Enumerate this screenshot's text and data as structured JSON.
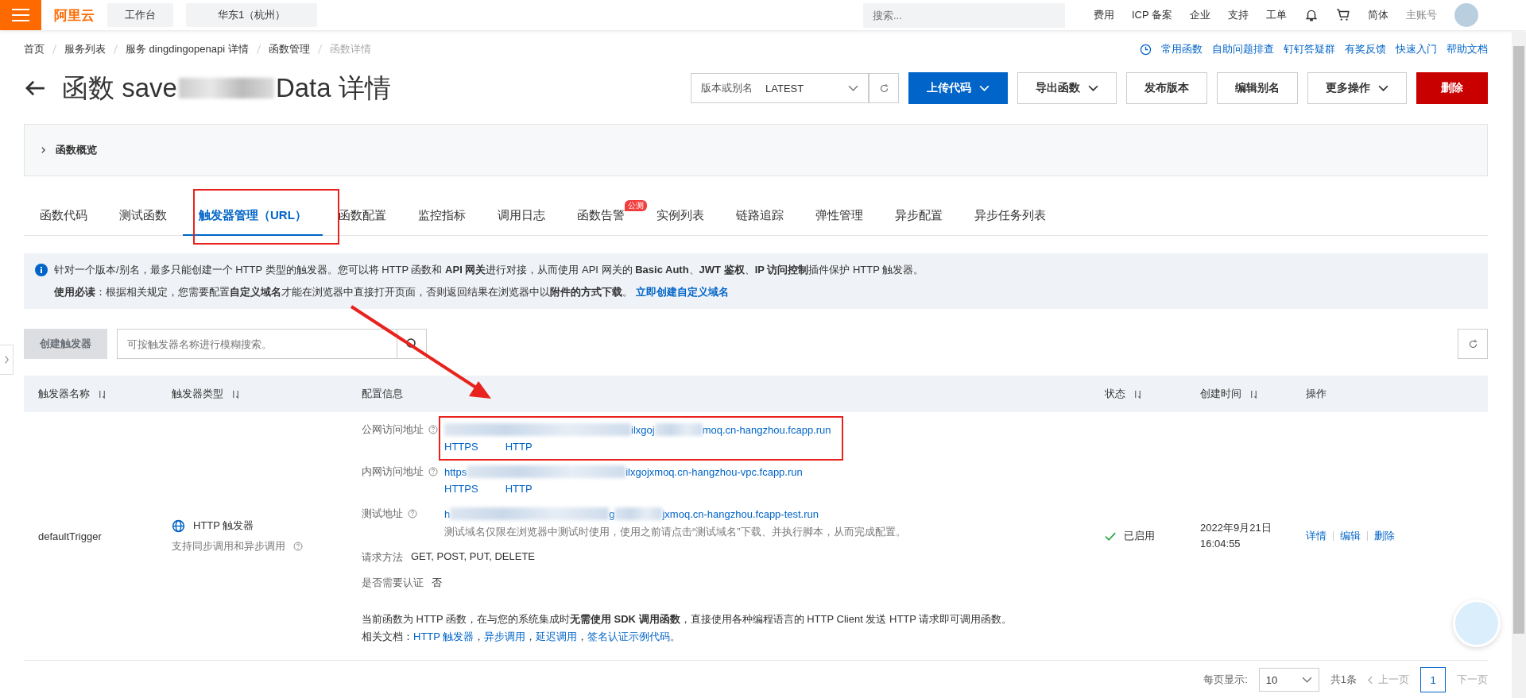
{
  "top_bar": {
    "logo": "阿里云",
    "workbench": "工作台",
    "region": "华东1（杭州）",
    "search": {
      "placeholder": "搜索..."
    },
    "links": [
      "费用",
      "ICP 备案",
      "企业",
      "支持",
      "工单"
    ],
    "language": "简体",
    "account": "主账号"
  },
  "breadcrumb": [
    {
      "label": "首页",
      "current": false
    },
    {
      "label": "服务列表",
      "current": false
    },
    {
      "label": "服务 dingdingopenapi 详情",
      "current": false
    },
    {
      "label": "函数管理",
      "current": false
    },
    {
      "label": "函数详情",
      "current": true
    }
  ],
  "help_links": [
    "常用函数",
    "自助问题排查",
    "钉钉答疑群",
    "有奖反馈",
    "快速入门",
    "帮助文档"
  ],
  "title": {
    "prefix": "函数 save",
    "suffix": "Data 详情"
  },
  "version_select": {
    "label": "版本或别名",
    "value": "LATEST"
  },
  "actions": [
    {
      "label": "上传代码",
      "kind": "primary",
      "dropdown": true
    },
    {
      "label": "导出函数",
      "kind": "default",
      "dropdown": true
    },
    {
      "label": "发布版本",
      "kind": "default",
      "dropdown": false
    },
    {
      "label": "编辑别名",
      "kind": "default",
      "dropdown": false
    },
    {
      "label": "更多操作",
      "kind": "default",
      "dropdown": true
    },
    {
      "label": "删除",
      "kind": "danger",
      "dropdown": false
    }
  ],
  "overview": {
    "label": "函数概览",
    "expanded": false
  },
  "tabs": [
    {
      "label": "函数代码",
      "selected": false
    },
    {
      "label": "测试函数",
      "selected": false
    },
    {
      "label": "触发器管理（URL）",
      "selected": true
    },
    {
      "label": "函数配置",
      "selected": false
    },
    {
      "label": "监控指标",
      "selected": false
    },
    {
      "label": "调用日志",
      "selected": false
    },
    {
      "label": "函数告警",
      "selected": false,
      "badge": "公测"
    },
    {
      "label": "实例列表",
      "selected": false
    },
    {
      "label": "链路追踪",
      "selected": false
    },
    {
      "label": "弹性管理",
      "selected": false
    },
    {
      "label": "异步配置",
      "selected": false
    },
    {
      "label": "异步任务列表",
      "selected": false
    }
  ],
  "notice": {
    "lines": [
      {
        "text": "针对一个版本/别名，最多只能创建一个 HTTP 类型的触发器。您可以将 HTTP 函数和 **API 网关**进行对接，从而使用 API 网关的 **Basic Auth**、**JWT 鉴权**、**IP 访问控制**插件保护 HTTP 触发器。"
      },
      {
        "text": "**使用必读**：根据相关规定，您需要配置**自定义域名**才能在浏览器中直接打开页面，否则返回结果在浏览器中以**附件的方式下载**。",
        "link": "立即创建自定义域名"
      }
    ]
  },
  "create_button": {
    "label": "创建触发器",
    "disabled": true
  },
  "search": {
    "placeholder": "可按触发器名称进行模糊搜索。"
  },
  "table": {
    "columns": [
      {
        "label": "触发器名称",
        "sortable": true
      },
      {
        "label": "触发器类型",
        "sortable": true
      },
      {
        "label": "配置信息",
        "sortable": false
      },
      {
        "label": "状态",
        "sortable": true
      },
      {
        "label": "创建时间",
        "sortable": true
      },
      {
        "label": "操作",
        "sortable": false
      }
    ],
    "rows": [
      {
        "name": "defaultTrigger",
        "type": {
          "label": "HTTP 触发器",
          "note": "支持同步调用和异步调用"
        },
        "config": {
          "addresses": [
            {
              "label": "公网访问地址",
              "segments": [
                {
                  "kind": "blur"
                },
                {
                  "kind": "text",
                  "text": "ilxgoj"
                },
                {
                  "kind": "blur"
                },
                {
                  "kind": "text",
                  "text": "moq.cn-hangzhou.fcapp.run"
                }
              ],
              "protocols": [
                "HTTPS",
                "HTTP"
              ]
            },
            {
              "label": "内网访问地址",
              "segments": [
                {
                  "kind": "text",
                  "text": "https"
                },
                {
                  "kind": "blur"
                },
                {
                  "kind": "text",
                  "text": "ilxgojxmoq.cn-hangzhou-vpc.fcapp.run"
                }
              ],
              "protocols": [
                "HTTPS",
                "HTTP"
              ]
            },
            {
              "label": "测试地址",
              "segments": [
                {
                  "kind": "text",
                  "text": "h"
                },
                {
                  "kind": "blur"
                },
                {
                  "kind": "text",
                  "text": "g"
                },
                {
                  "kind": "blur"
                },
                {
                  "kind": "text",
                  "text": "jxmoq.cn-hangzhou.fcapp-test.run"
                }
              ],
              "note": "测试域名仅限在浏览器中测试时使用，使用之前请点击“测试域名”下载、并执行脚本，从而完成配置。"
            }
          ],
          "method": {
            "label": "请求方法",
            "value": "GET, POST, PUT, DELETE"
          },
          "auth": {
            "label": "是否需要认证",
            "value": "否"
          },
          "footer": "当前函数为 HTTP 函数，在与您的系统集成时**无需使用 SDK 调用函数**，直接使用各种编程语言的 HTTP Client 发送 HTTP 请求即可调用函数。",
          "docs": {
            "label": "相关文档：",
            "links": [
              "HTTP 触发器",
              "异步调用",
              "延迟调用",
              "签名认证示例代码"
            ],
            "separator": "，",
            "end": "。"
          }
        },
        "status": {
          "label": "已启用",
          "enabled": true
        },
        "created": "2022年9月21日 16:04:55",
        "actions": [
          "详情",
          "编辑",
          "删除"
        ]
      }
    ]
  },
  "pagination": {
    "page_size_label": "每页显示:",
    "page_size": "10",
    "total": "共1条",
    "prev": "上一页",
    "pages": [
      {
        "label": "1",
        "selected": true
      }
    ],
    "next": "下一页"
  }
}
